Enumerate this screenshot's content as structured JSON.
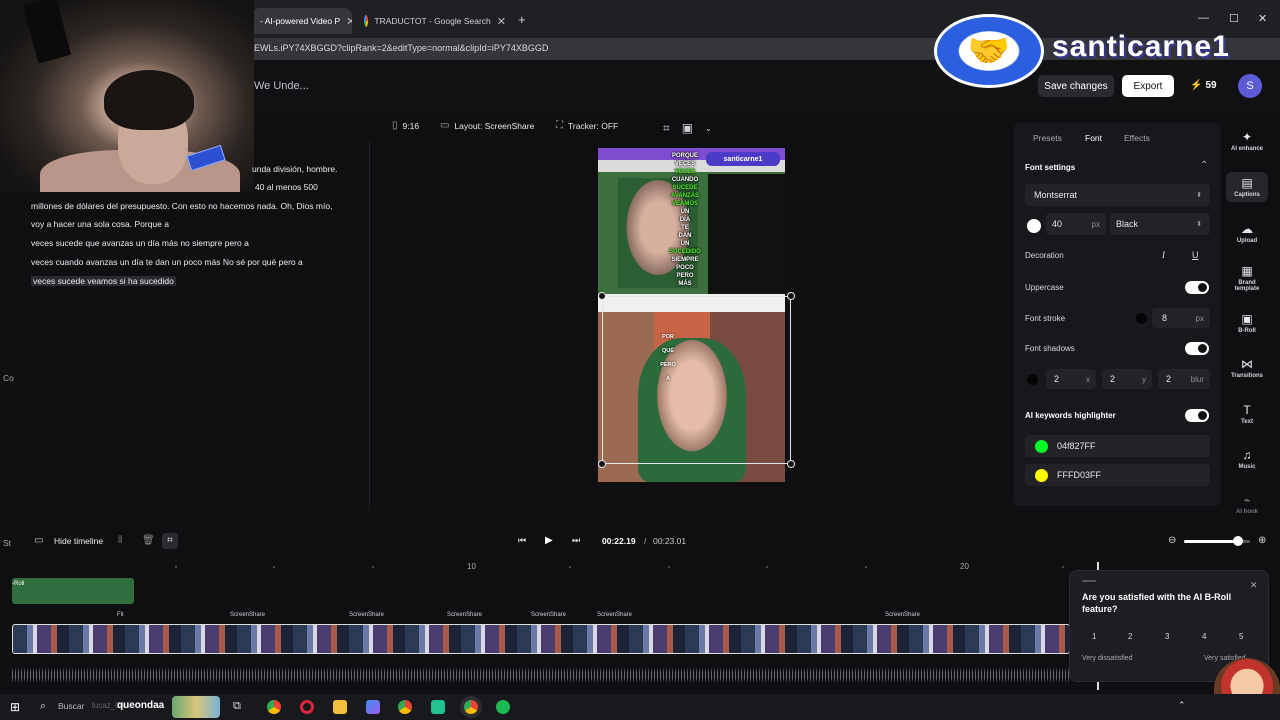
{
  "browser": {
    "tabs": [
      {
        "label": "- AI-powered Video P",
        "active": true
      },
      {
        "label": "TRADUCTOT - Google Search",
        "active": false
      }
    ],
    "url": "EWLs.iPY74XBGGD?clipRank=2&editType=normal&clipId=iPY74XBGGD"
  },
  "header": {
    "project_title": "We Unde...",
    "save_label": "Save changes",
    "export_label": "Export",
    "credits": "59",
    "avatar_initial": "S"
  },
  "overlay": {
    "brand_name": "santicarne1"
  },
  "transcript": {
    "lines": [
      "unda división, hombre.",
      "40 al menos 500",
      "millones de dólares del presupuesto. Con esto no hacemos nada. Oh, Dios mío,",
      "voy a hacer una sola cosa. Porque a",
      "veces sucede que avanzas un día más no siempre pero a",
      "veces cuando avanzas un día te dan un poco más No sé por qué pero a",
      "veces sucede veamos si ha sucedido"
    ],
    "edge_fragments": [
      "Co",
      "St"
    ]
  },
  "preview_toolbar": {
    "aspect": "9:16",
    "layout": "Layout: ScreenShare",
    "tracker": "Tracker: OFF"
  },
  "preview": {
    "logo_text": "santicarne1",
    "caption_top": [
      "PORQUE",
      "VECES",
      "VECES",
      "CUANDO",
      "SUCEDE",
      "AVANZAS",
      "VEAMOS",
      "UN",
      "DÍA",
      "TE",
      "DAN",
      "UN",
      "SUCEDIDO",
      "SIEMPRE",
      "POCO",
      "PERO",
      "MÁS"
    ],
    "caption_bottom": [
      "POR",
      "QUÉ",
      "PERO",
      "A"
    ]
  },
  "right_panel": {
    "tabs": [
      "Presets",
      "Font",
      "Effects"
    ],
    "active_tab": "Font",
    "section_title": "Font settings",
    "font_family": "Montserrat",
    "font_size": "40",
    "font_size_unit": "px",
    "font_weight": "Black",
    "decoration_label": "Decoration",
    "uppercase_label": "Uppercase",
    "font_stroke_label": "Font stroke",
    "font_stroke_value": "8",
    "font_stroke_unit": "px",
    "font_shadows_label": "Font shadows",
    "shadow_x": "2",
    "shadow_x_unit": "x",
    "shadow_y": "2",
    "shadow_y_unit": "y",
    "shadow_blur": "2",
    "shadow_blur_unit": "blur",
    "keywords_label": "AI keywords highlighter",
    "color1": "04f827FF",
    "color2": "FFFD03FF",
    "colors": {
      "green": "#04f827",
      "yellow": "#fffd03",
      "accent": "#5b5bd6"
    }
  },
  "right_rail": [
    {
      "label": "AI enhance",
      "icon": "sparkle-icon"
    },
    {
      "label": "Captions",
      "icon": "captions-icon"
    },
    {
      "label": "Upload",
      "icon": "upload-icon"
    },
    {
      "label": "Brand template",
      "icon": "grid-icon"
    },
    {
      "label": "B-Roll",
      "icon": "broll-icon"
    },
    {
      "label": "Transitions",
      "icon": "transitions-icon"
    },
    {
      "label": "Text",
      "icon": "text-icon"
    },
    {
      "label": "Music",
      "icon": "music-icon"
    },
    {
      "label": "AI hook",
      "icon": "hook-icon"
    }
  ],
  "timeline": {
    "hide_label": "Hide timeline",
    "current_time": "00:22.19",
    "separator": "/",
    "total_time": "00:23.01",
    "ruler_marks": [
      "10",
      "20"
    ],
    "zoom_level": 0.82,
    "clip_labels": [
      "Fit",
      "ScreenShare",
      "ScreenShare",
      "ScreenShare",
      "ScreenShare",
      "ScreenShare",
      "ScreenShare"
    ],
    "broll_label": "-Roll"
  },
  "feedback": {
    "question": "Are you satisfied with the AI B-Roll feature?",
    "options": [
      "1",
      "2",
      "3",
      "4",
      "5"
    ],
    "low_label": "Very dissatisfied",
    "high_label": "Very satisfied"
  },
  "taskbar": {
    "search_label": "Buscar",
    "overlay_text": "queondaa",
    "faded_text": "lucaz_06"
  }
}
